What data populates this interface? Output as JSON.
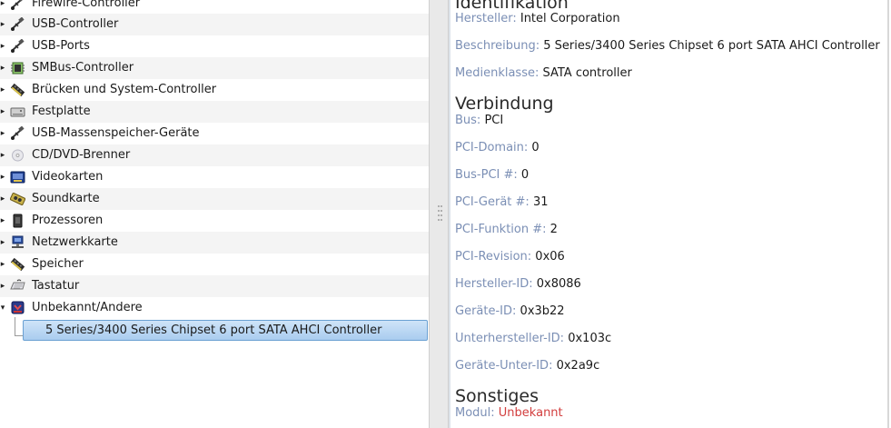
{
  "tree": {
    "items": [
      {
        "label": "Firewire-Controller",
        "icon": "usb-plug-icon",
        "expander": "collapsed"
      },
      {
        "label": "USB-Controller",
        "icon": "usb-plug-icon",
        "expander": "collapsed"
      },
      {
        "label": "USB-Ports",
        "icon": "usb-plug-icon",
        "expander": "collapsed"
      },
      {
        "label": "SMBus-Controller",
        "icon": "smbus-chip-icon",
        "expander": "collapsed"
      },
      {
        "label": "Brücken und System-Controller",
        "icon": "memory-module-icon",
        "expander": "collapsed"
      },
      {
        "label": "Festplatte",
        "icon": "hard-disk-icon",
        "expander": "collapsed"
      },
      {
        "label": "USB-Massenspeicher-Geräte",
        "icon": "usb-plug-icon",
        "expander": "collapsed"
      },
      {
        "label": "CD/DVD-Brenner",
        "icon": "optical-disc-icon",
        "expander": "collapsed"
      },
      {
        "label": "Videokarten",
        "icon": "video-card-icon",
        "expander": "collapsed"
      },
      {
        "label": "Soundkarte",
        "icon": "sound-card-icon",
        "expander": "collapsed"
      },
      {
        "label": "Prozessoren",
        "icon": "processor-icon",
        "expander": "collapsed"
      },
      {
        "label": "Netzwerkkarte",
        "icon": "network-card-icon",
        "expander": "collapsed"
      },
      {
        "label": "Speicher",
        "icon": "memory-module-icon",
        "expander": "collapsed"
      },
      {
        "label": "Tastatur",
        "icon": "keyboard-icon",
        "expander": "collapsed"
      },
      {
        "label": "Unbekannt/Andere",
        "icon": "unknown-device-icon",
        "expander": "expanded"
      }
    ],
    "selected_child": {
      "label": "5 Series/3400 Series Chipset 6 port SATA AHCI Controller"
    }
  },
  "details": {
    "identifikation": {
      "title": "Identifikation",
      "hersteller": {
        "key": "Hersteller:",
        "value": "Intel Corporation"
      },
      "beschreibung": {
        "key": "Beschreibung:",
        "value": "5 Series/3400 Series Chipset 6 port SATA AHCI Controller"
      },
      "medienklasse": {
        "key": "Medienklasse:",
        "value": "SATA controller"
      }
    },
    "verbindung": {
      "title": "Verbindung",
      "props": [
        {
          "key": "Bus:",
          "value": "PCI"
        },
        {
          "key": "PCI-Domain:",
          "value": "0"
        },
        {
          "key": "Bus-PCI #:",
          "value": "0"
        },
        {
          "key": "PCI-Gerät #:",
          "value": "31"
        },
        {
          "key": "PCI-Funktion #:",
          "value": "2"
        },
        {
          "key": "PCI-Revision:",
          "value": "0x06"
        },
        {
          "key": "Hersteller-ID:",
          "value": "0x8086"
        },
        {
          "key": "Geräte-ID:",
          "value": "0x3b22"
        },
        {
          "key": "Unterhersteller-ID:",
          "value": "0x103c"
        },
        {
          "key": "Geräte-Unter-ID:",
          "value": "0x2a9c"
        }
      ]
    },
    "sonstiges": {
      "title": "Sonstiges",
      "modul": {
        "key": "Modul:",
        "value": "Unbekannt",
        "value_color": "#d23d3d"
      }
    }
  },
  "colors": {
    "key_label": "#7b8fb5",
    "selection": "#a9ccef",
    "alt_row": "#f4f4f4"
  }
}
